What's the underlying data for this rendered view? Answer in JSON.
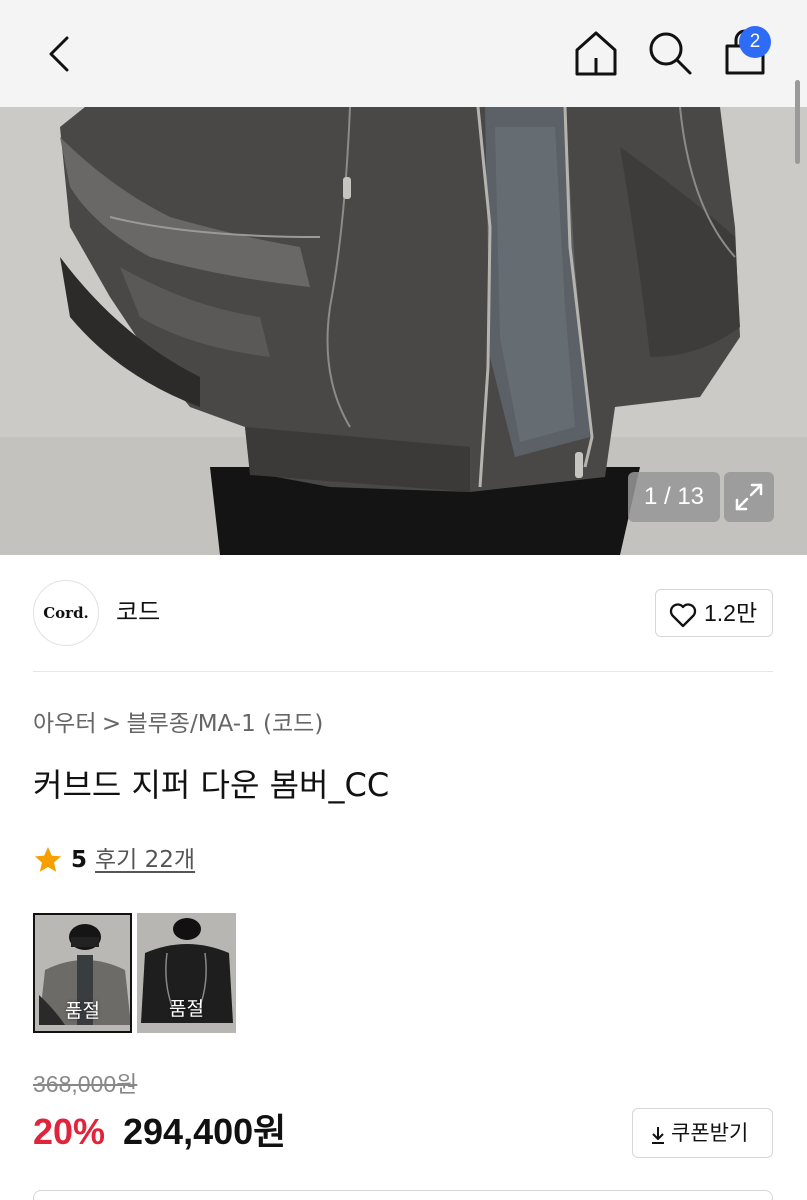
{
  "header": {
    "back_icon": "chevron-left-icon",
    "home_icon": "home-icon",
    "search_icon": "search-icon",
    "cart_icon": "shopping-bag-icon",
    "cart_badge": "2",
    "badge_color": "#2f6cf6"
  },
  "gallery": {
    "counter": "1 / 13",
    "expand_icon": "expand-icon"
  },
  "brand": {
    "logo_text": "Cord.",
    "name": "코드",
    "like_icon": "heart-outline-icon",
    "like_count": "1.2만"
  },
  "product": {
    "breadcrumb": [
      "아우터",
      "블루종/MA-1 (코드)"
    ],
    "breadcrumb_separator": ">",
    "title": "커브드 지퍼 다운 봄버_CC",
    "rating_icon": "star-icon",
    "rating": "5",
    "review_link": "후기 22개",
    "options": [
      {
        "label": "품절",
        "color_tone": "gray"
      },
      {
        "label": "품절",
        "color_tone": "black"
      }
    ]
  },
  "price": {
    "original": "368,000원",
    "discount": "20%",
    "sale": "294,400원",
    "discount_color": "#e0243b",
    "coupon_icon": "download-arrow-icon",
    "coupon_label": "쿠폰받기"
  }
}
